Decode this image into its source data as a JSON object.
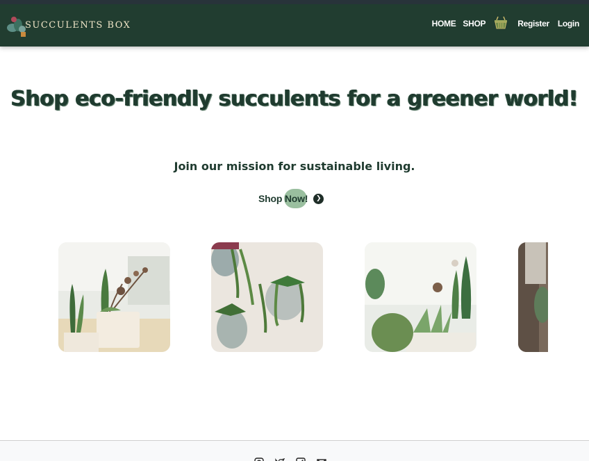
{
  "brand": {
    "logo_text": "SUCCULENTS BOX",
    "colors": {
      "nav_bg": "#213d30",
      "accent_green": "#8fb895",
      "text_dark": "#1f3b2f"
    }
  },
  "nav": {
    "home": "HOME",
    "shop": "SHOP",
    "cart_icon": "basket-icon",
    "register": "Register",
    "login": "Login"
  },
  "hero": {
    "title": "Shop eco-friendly succulents for a greener world!",
    "subtitle": "Join our mission for sustainable living.",
    "cta_label": "Shop Now!",
    "cta_icon": "arrow-right-circle-icon"
  },
  "gallery": {
    "items": [
      {
        "icon": "succulent-photo-1"
      },
      {
        "icon": "succulent-photo-2"
      },
      {
        "icon": "succulent-photo-3"
      },
      {
        "icon": "succulent-photo-4"
      }
    ]
  },
  "footer": {
    "social_icons": [
      "instagram-icon",
      "twitter-icon",
      "facebook-icon",
      "email-icon"
    ]
  }
}
